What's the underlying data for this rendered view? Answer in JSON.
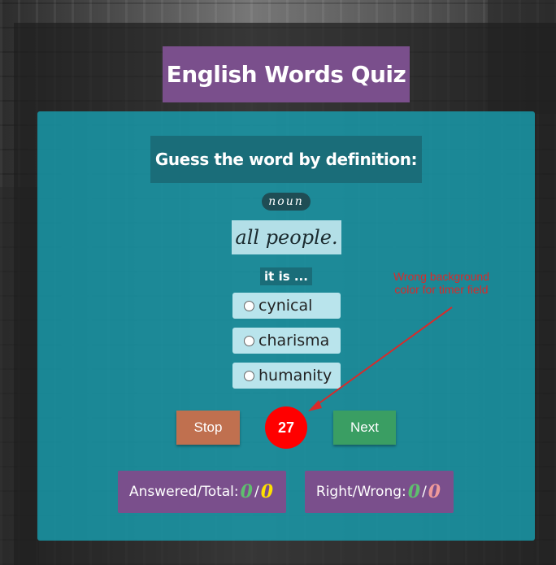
{
  "quiz": {
    "title": "English Words Quiz",
    "prompt": "Guess the word by definition:",
    "part_of_speech": "noun",
    "definition": "all people.",
    "it_is": "it is ...",
    "options": [
      "cynical",
      "charisma",
      "humanity"
    ]
  },
  "controls": {
    "stop_label": "Stop",
    "next_label": "Next",
    "timer_value": "27"
  },
  "annotation": {
    "text": "Wrong background color for timer field",
    "color": "#d92a2a"
  },
  "scores": {
    "answered_label": "Answered/Total:",
    "answered": "0",
    "total": "0",
    "right_wrong_label": "Right/Wrong:",
    "right": "0",
    "wrong": "0",
    "separator": "/"
  },
  "colors": {
    "title_bg": "#7a4f8c",
    "panel_bg": "#17a3b5",
    "stop_bg": "#c0704f",
    "next_bg": "#3a9e63",
    "timer_bg": "#ff0000"
  }
}
